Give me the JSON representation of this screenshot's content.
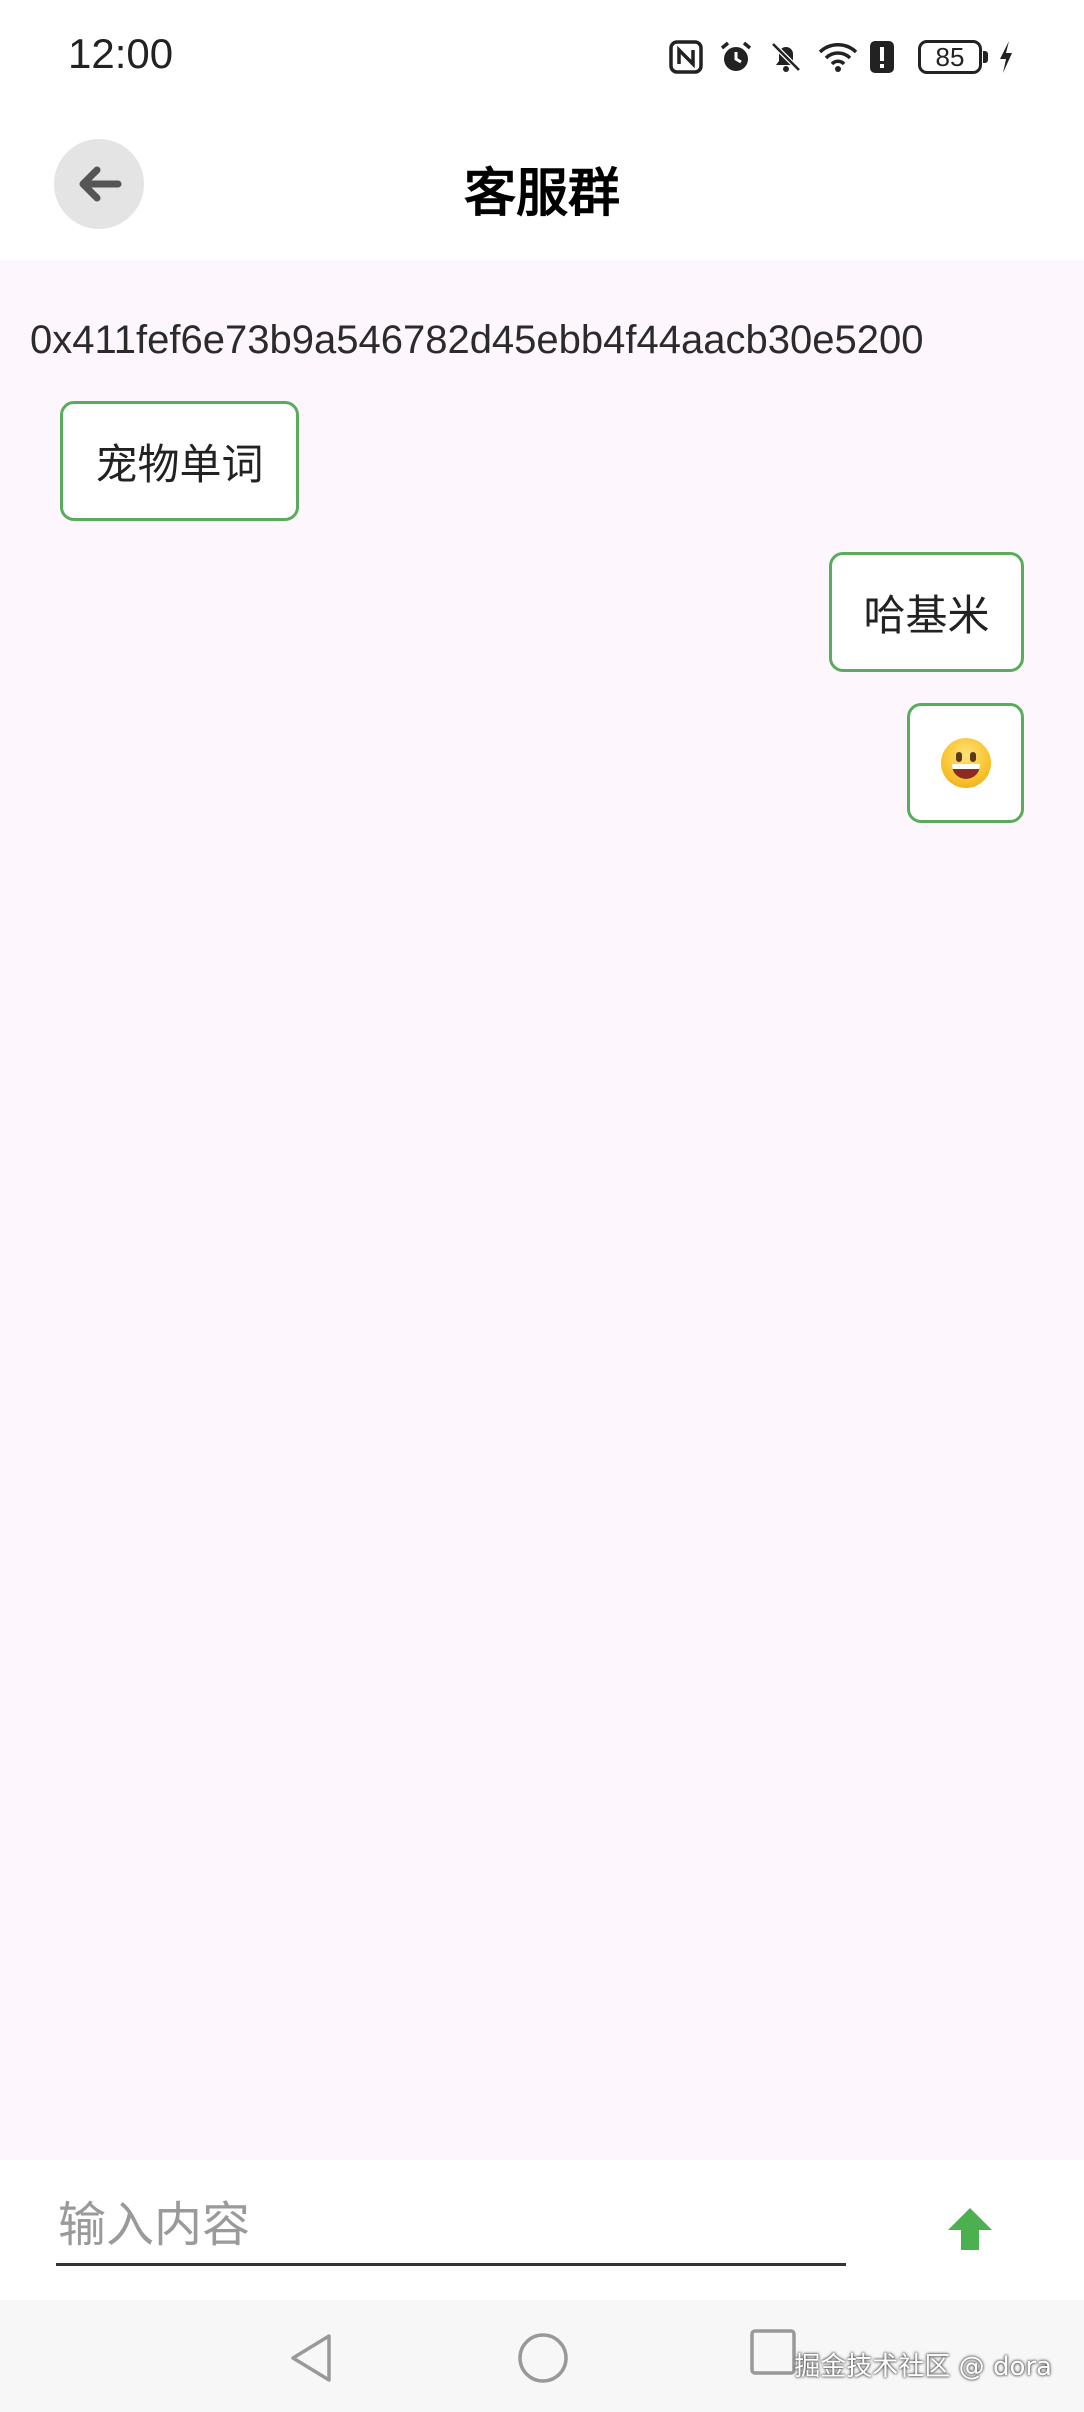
{
  "status_bar": {
    "time": "12:00",
    "battery": "85",
    "icons": [
      "nfc-icon",
      "alarm-icon",
      "bell-off-icon",
      "wifi-icon",
      "alert-icon",
      "battery-icon",
      "charging-icon"
    ]
  },
  "app_bar": {
    "title": "客服群",
    "back_icon": "arrow-left-icon"
  },
  "chat": {
    "user_id": "0x411fef6e73b9a546782d45ebb4f44aacb30e5200",
    "messages": [
      {
        "side": "left",
        "text": "宠物单词"
      },
      {
        "side": "right",
        "text": "哈基米"
      },
      {
        "side": "right",
        "emoji": "grinning-face-emoji"
      }
    ]
  },
  "input": {
    "placeholder": "输入内容",
    "value": "",
    "send_icon": "arrow-up-icon"
  },
  "watermark": "掘金技术社区 @ dora",
  "colors": {
    "accent_green": "#4caf50",
    "bubble_border": "#5aac5d",
    "chat_background": "#fdf7fd"
  }
}
